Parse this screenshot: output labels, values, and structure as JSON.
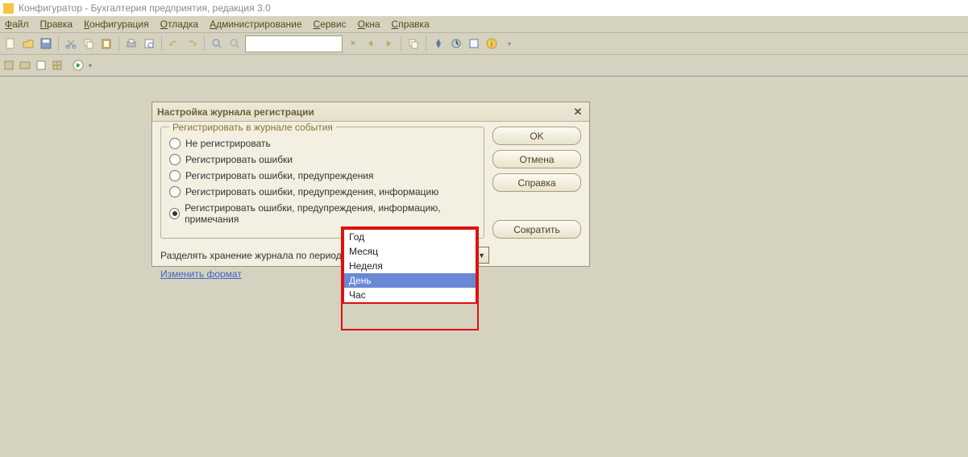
{
  "app": {
    "title": "Конфигуратор - Бухгалтерия предприятия, редакция 3.0"
  },
  "menu": {
    "file": "айл",
    "edit": "равка",
    "config": "онфигурация",
    "debug": "тладка",
    "admin": "дминистрирование",
    "service": "ервис",
    "windows": "кна",
    "help": "правка",
    "p_file": "Ф",
    "p_edit": "П",
    "p_config": "К",
    "p_debug": "О",
    "p_admin": "А",
    "p_service": "С",
    "p_windows": "О",
    "p_help": "С"
  },
  "dialog": {
    "title": "Настройка журнала регистрации",
    "fieldset_legend": "Регистрировать в журнале события",
    "radios": {
      "r0": "Не регистрировать",
      "r1": "Регистрировать ошибки",
      "r2": "Регистрировать ошибки, предупреждения",
      "r3": "Регистрировать ошибки, предупреждения, информацию",
      "r4": "Регистрировать ошибки, предупреждения, информацию, примечания"
    },
    "buttons": {
      "ok": "OK",
      "cancel": "Отмена",
      "help": "Справка",
      "shrink": "Сократить"
    },
    "split_label": "Разделять хранение журнала по периодам",
    "combo_value": "День",
    "change_format": "Изменить формат"
  },
  "dropdown": {
    "o0": "Год",
    "o1": "Месяц",
    "o2": "Неделя",
    "o3": "День",
    "o4": "Час"
  }
}
